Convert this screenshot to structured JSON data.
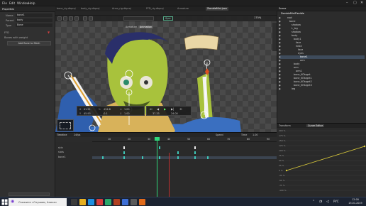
{
  "menu": {
    "items": [
      "File",
      "Edit",
      "Window",
      "Help"
    ]
  },
  "left_panel": {
    "tab_label": "Properties",
    "fields": [
      {
        "label": "Name",
        "value": "bone1"
      },
      {
        "label": "Parent",
        "value": "body"
      },
      {
        "label": "Type",
        "value": "Bone"
      }
    ],
    "section": "FFD",
    "checkbox_label": "Bones with weight",
    "action_button": "Add Bone to Mesh"
  },
  "file_tabs": [
    "bone_rig.dbproj",
    "body_rig.dbproj",
    "Arms_rig.dbproj",
    "FFD_rig.dbproj",
    "Armature",
    "ZombieMini.json"
  ],
  "viewport": {
    "mode_tabs": [
      "Armature",
      "Animation"
    ],
    "active_mode": "Animation",
    "sync_label": "Sync",
    "zoom": "175%"
  },
  "transform": {
    "x": "41.21",
    "y": "45.93",
    "rot": "-124.8",
    "sx": "1.00",
    "sy": "1.00",
    "sz": "-0.1"
  },
  "playback": {
    "time": "37.33",
    "total": "24.00"
  },
  "timeline": {
    "tab": "Timeline",
    "fps_label": "24fps",
    "speed_label": "Speed",
    "time_label": "Time",
    "time_value": "1.00",
    "tracks": [
      "skin",
      "slots",
      "bone1"
    ],
    "ticks": [
      "10",
      "20",
      "30",
      "40",
      "50",
      "60",
      "70",
      "80",
      "90"
    ]
  },
  "scene_tree": {
    "tab": "Scene",
    "root": "ZombieMiniFlexible",
    "items": [
      {
        "label": "root",
        "level": 1
      },
      {
        "label": "bone",
        "level": 2
      },
      {
        "label": "shadow",
        "level": 3
      },
      {
        "label": "L_leg",
        "level": 3
      },
      {
        "label": "shadow",
        "level": 3
      },
      {
        "label": "body",
        "level": 3
      },
      {
        "label": "body1",
        "level": 4
      },
      {
        "label": "face",
        "level": 5
      },
      {
        "label": "head",
        "level": 5
      },
      {
        "label": "face",
        "level": 6
      },
      {
        "label": "eyes",
        "level": 6
      },
      {
        "label": "bone1",
        "level": 7
      },
      {
        "label": "arm",
        "level": 7
      },
      {
        "label": "body",
        "level": 4
      },
      {
        "label": "arm",
        "level": 4
      },
      {
        "label": "arm1",
        "level": 5
      },
      {
        "label": "bone_IKTarget",
        "level": 4
      },
      {
        "label": "bone_IKTarget1",
        "level": 4
      },
      {
        "label": "bone_IKTarget2",
        "level": 4
      },
      {
        "label": "bone_IKTarget3",
        "level": 4
      },
      {
        "label": "leg",
        "level": 3
      }
    ],
    "selected_index": 11
  },
  "graph": {
    "tabs": [
      "Transform",
      "Curve Editor"
    ],
    "y_labels": [
      "200 %",
      "175 %",
      "150 %",
      "125 %",
      "100 %",
      "75 %",
      "50 %",
      "25 %",
      "0 %",
      "-25 %",
      "-50 %",
      "-75 %",
      "-100 %"
    ]
  },
  "taskbar": {
    "search_placeholder": "Скажите «Слушаю, Алиса»",
    "time": "12:00",
    "date": "15.01.2019"
  },
  "colors": {
    "accent_keyframe": "#3ec7b8",
    "playhead": "#2fd67a",
    "selection": "#3e4b5b"
  }
}
